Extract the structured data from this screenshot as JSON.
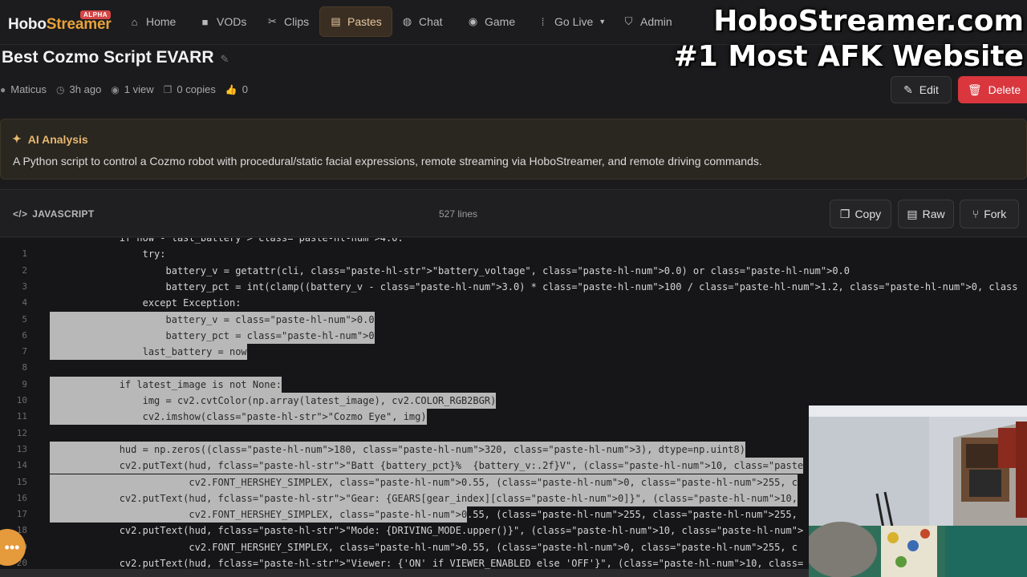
{
  "app": {
    "logo_prefix": "Hobo",
    "logo_accent": "Streamer",
    "badge": "ALPHA"
  },
  "nav": {
    "items": [
      {
        "label": "Home",
        "icon": "home-icon"
      },
      {
        "label": "VODs",
        "icon": "video-icon"
      },
      {
        "label": "Clips",
        "icon": "scissors-icon"
      },
      {
        "label": "Pastes",
        "icon": "paste-icon",
        "active": true
      },
      {
        "label": "Chat",
        "icon": "chat-icon"
      },
      {
        "label": "Game",
        "icon": "gamepad-icon"
      },
      {
        "label": "Go Live",
        "icon": "broadcast-icon"
      },
      {
        "label": "Admin",
        "icon": "shield-icon"
      }
    ]
  },
  "overlay": {
    "line1": "HoboStreamer.com",
    "line2": "#1 Most AFK Website"
  },
  "paste": {
    "title": "Best Cozmo Script EVARR",
    "author": "Maticus",
    "time": "3h ago",
    "views": "1 view",
    "copies": "0 copies",
    "likes": "0",
    "edit_label": "Edit",
    "delete_label": "Delete"
  },
  "ai": {
    "title": "AI Analysis",
    "text": "A Python script to control a Cozmo robot with procedural/static facial expressions, remote streaming via HoboStreamer, and remote driving commands."
  },
  "code_header": {
    "language": "JAVASCRIPT",
    "lines": "527 lines",
    "copy_label": "Copy",
    "raw_label": "Raw",
    "fork_label": "Fork"
  },
  "code": {
    "lines": [
      {
        "n": "",
        "text": "            if now - last_battery > class=\"paste-hl-num\">4.0:",
        "sel": false
      },
      {
        "n": "1",
        "text": "                try:",
        "sel": false
      },
      {
        "n": "2",
        "text": "                    battery_v = getattr(cli, class=\"paste-hl-str\">\"battery_voltage\", class=\"paste-hl-num\">0.0) or class=\"paste-hl-num\">0.0",
        "sel": false
      },
      {
        "n": "3",
        "text": "                    battery_pct = int(clamp((battery_v - class=\"paste-hl-num\">3.0) * class=\"paste-hl-num\">100 / class=\"paste-hl-num\">1.2, class=\"paste-hl-num\">0, class",
        "sel": false
      },
      {
        "n": "4",
        "text": "                except Exception:",
        "sel": false
      },
      {
        "n": "5",
        "text": "                    battery_v = class=\"paste-hl-num\">0.0",
        "sel": true
      },
      {
        "n": "6",
        "text": "                    battery_pct = class=\"paste-hl-num\">0",
        "sel": true
      },
      {
        "n": "7",
        "text": "                last_battery = now",
        "sel": true
      },
      {
        "n": "8",
        "text": "",
        "sel": false
      },
      {
        "n": "9",
        "text": "            if latest_image is not None:",
        "sel": true
      },
      {
        "n": "10",
        "text": "                img = cv2.cvtColor(np.array(latest_image), cv2.COLOR_RGB2BGR)",
        "sel": true
      },
      {
        "n": "11",
        "text": "                cv2.imshow(class=\"paste-hl-str\">\"Cozmo Eye\", img)",
        "sel": true
      },
      {
        "n": "12",
        "text": "",
        "sel": false
      },
      {
        "n": "13",
        "text": "            hud = np.zeros((class=\"paste-hl-num\">180, class=\"paste-hl-num\">320, class=\"paste-hl-num\">3), dtype=np.uint8)",
        "sel": true
      },
      {
        "n": "14",
        "text": "            cv2.putText(hud, fclass=\"paste-hl-str\">\"Batt {battery_pct}%  {battery_v:.2f}V\", (class=\"paste-hl-num\">10, class=\"paste",
        "sel": true
      },
      {
        "n": "15",
        "text": "                        cv2.FONT_HERSHEY_SIMPLEX, class=\"paste-hl-num\">0.55, (class=\"paste-hl-num\">0, class=\"paste-hl-num\">255, c",
        "sel": true
      },
      {
        "n": "16",
        "text": "            cv2.putText(hud, fclass=\"paste-hl-str\">\"Gear: {GEARS[gear_index][class=\"paste-hl-num\">0]}\", (class=\"paste-hl-num\">10,",
        "sel": true
      },
      {
        "n": "17",
        "text": "                        cv2.FONT_HERSHEY_SIMPLEX, class=\"paste-hl-num\">0",
        "sel": true,
        "tail": ".55, (class=\"paste-hl-num\">255, class=\"paste-hl-num\">255,"
      },
      {
        "n": "18",
        "text": "            cv2.putText(hud, fclass=\"paste-hl-str\">\"Mode: {DRIVING_MODE.upper()}\", (class=\"paste-hl-num\">10, class=\"paste-hl-num\">",
        "sel": false
      },
      {
        "n": "19",
        "text": "                        cv2.FONT_HERSHEY_SIMPLEX, class=\"paste-hl-num\">0.55, (class=\"paste-hl-num\">0, class=\"paste-hl-num\">255, c",
        "sel": false
      },
      {
        "n": "20",
        "text": "            cv2.putText(hud, fclass=\"paste-hl-str\">\"Viewer: {'ON' if VIEWER_ENABLED else 'OFF'}\", (class=\"paste-hl-num\">10, class=",
        "sel": false
      }
    ]
  },
  "colors": {
    "accent": "#e8a23a",
    "delete": "#d9363e",
    "selection": "#b8b8b8"
  }
}
